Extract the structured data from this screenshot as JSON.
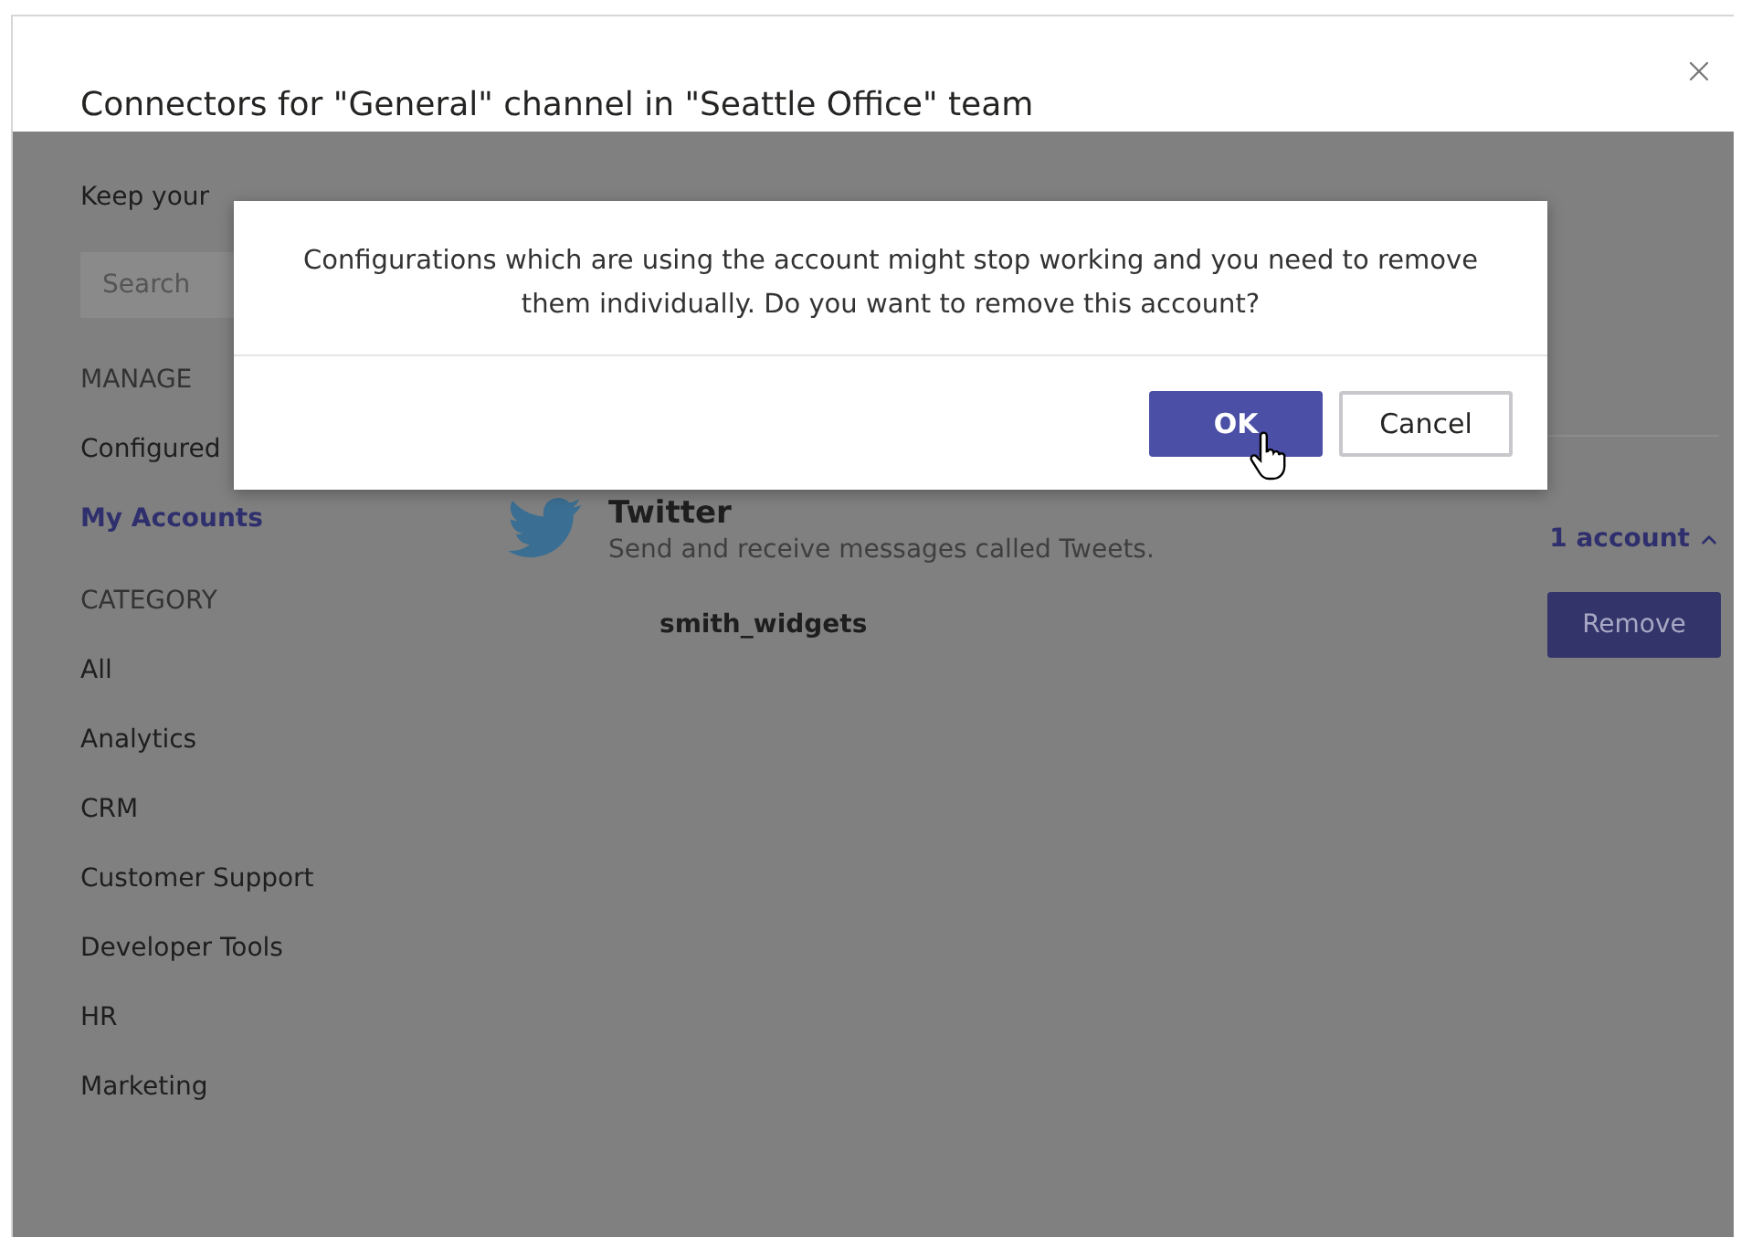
{
  "window": {
    "title": "Connectors for \"General\" channel in \"Seattle Office\" team"
  },
  "sidebar": {
    "intro": "Keep your",
    "search": {
      "placeholder": "Search"
    },
    "sections": [
      {
        "heading": "MANAGE",
        "items": [
          {
            "label": "Configured",
            "selected": false
          },
          {
            "label": "My Accounts",
            "selected": true
          }
        ]
      },
      {
        "heading": "CATEGORY",
        "items": [
          {
            "label": "All",
            "selected": false
          },
          {
            "label": "Analytics",
            "selected": false
          },
          {
            "label": "CRM",
            "selected": false
          },
          {
            "label": "Customer Support",
            "selected": false
          },
          {
            "label": "Developer Tools",
            "selected": false
          },
          {
            "label": "HR",
            "selected": false
          },
          {
            "label": "Marketing",
            "selected": false
          }
        ]
      }
    ]
  },
  "connector": {
    "name": "Twitter",
    "description": "Send and receive messages called Tweets.",
    "accounts_toggle": "1 account",
    "expanded": true,
    "accounts": [
      {
        "name": "smith_widgets",
        "action": "Remove"
      }
    ]
  },
  "dialog": {
    "message": "Configurations which are using the account might stop working and you need to remove them individually. Do you want to remove this account?",
    "buttons": [
      {
        "label": "OK",
        "kind": "primary"
      },
      {
        "label": "Cancel",
        "kind": "secondary"
      }
    ]
  }
}
